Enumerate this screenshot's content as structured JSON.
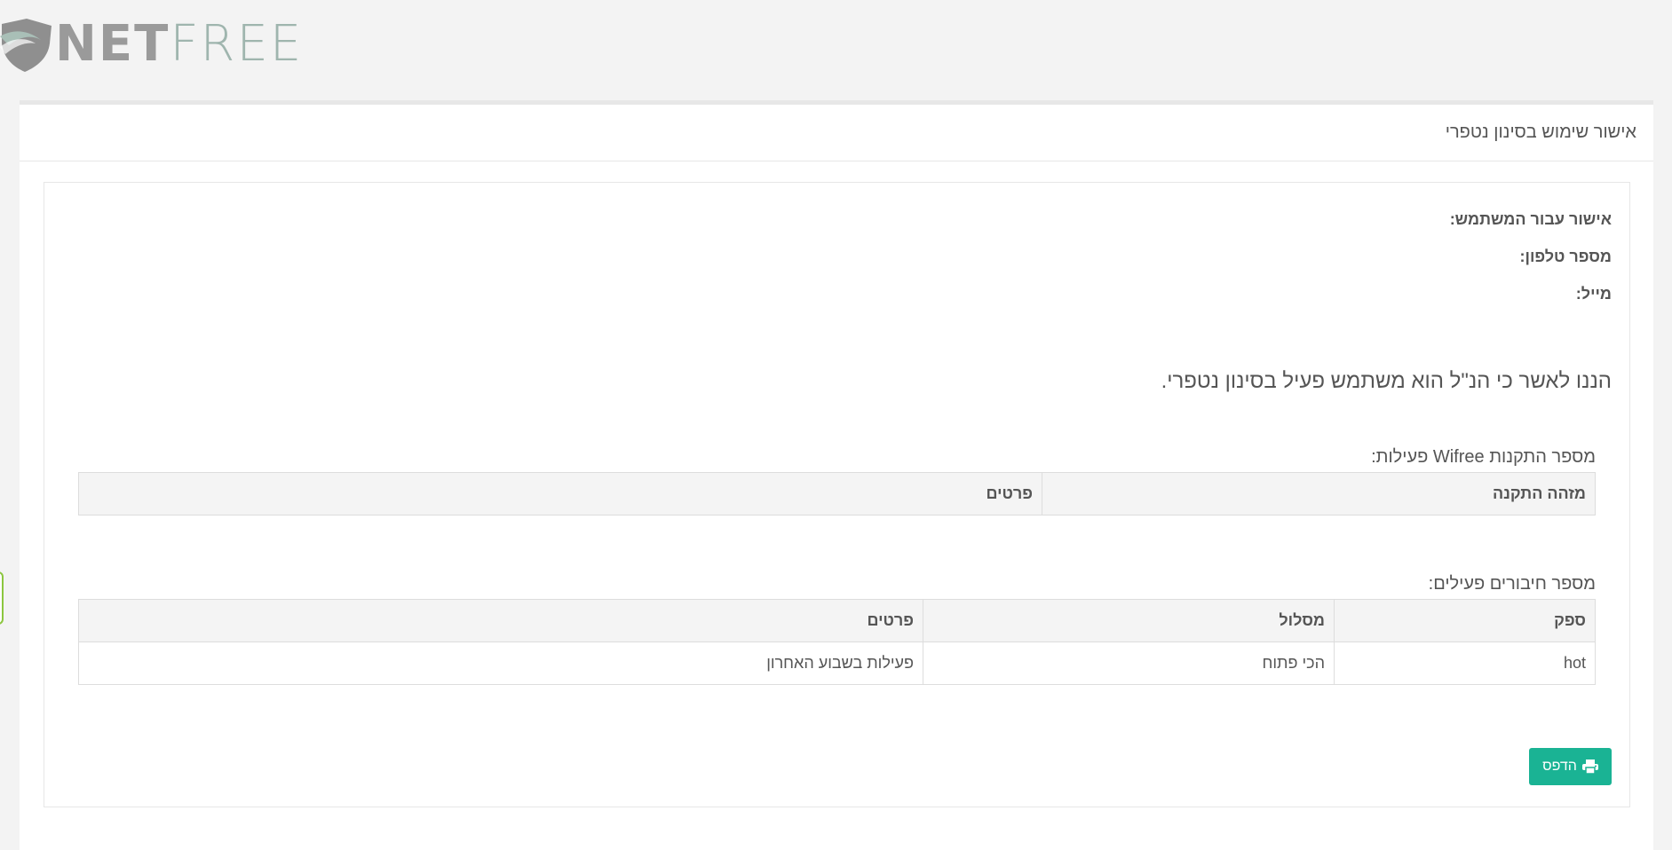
{
  "logo": {
    "net": "NET",
    "free": "FREE"
  },
  "panel": {
    "title": "אישור שימוש בסינון נטפרי"
  },
  "fields": {
    "user_label": "אישור עבור המשתמש:",
    "phone_label": "מספר טלפון:",
    "email_label": "מייל:"
  },
  "statement": "הננו לאשר כי הנ\"ל הוא משתמש פעיל בסינון נטפרי.",
  "wifree": {
    "title": "מספר התקנות Wifree פעילות:",
    "columns": [
      "מזהה התקנה",
      "פרטים"
    ],
    "rows": []
  },
  "connections": {
    "title": "מספר חיבורים פעילים:",
    "columns": [
      "ספק",
      "מסלול",
      "פרטים"
    ],
    "rows": [
      [
        "hot",
        "הכי פתוח",
        "פעילות בשבוע האחרון"
      ]
    ]
  },
  "print_button": {
    "label": "הדפס",
    "icon": "print-icon"
  },
  "colors": {
    "accent": "#1ab394",
    "side_tab": "#8cc63f",
    "background": "#f3f3f3"
  }
}
